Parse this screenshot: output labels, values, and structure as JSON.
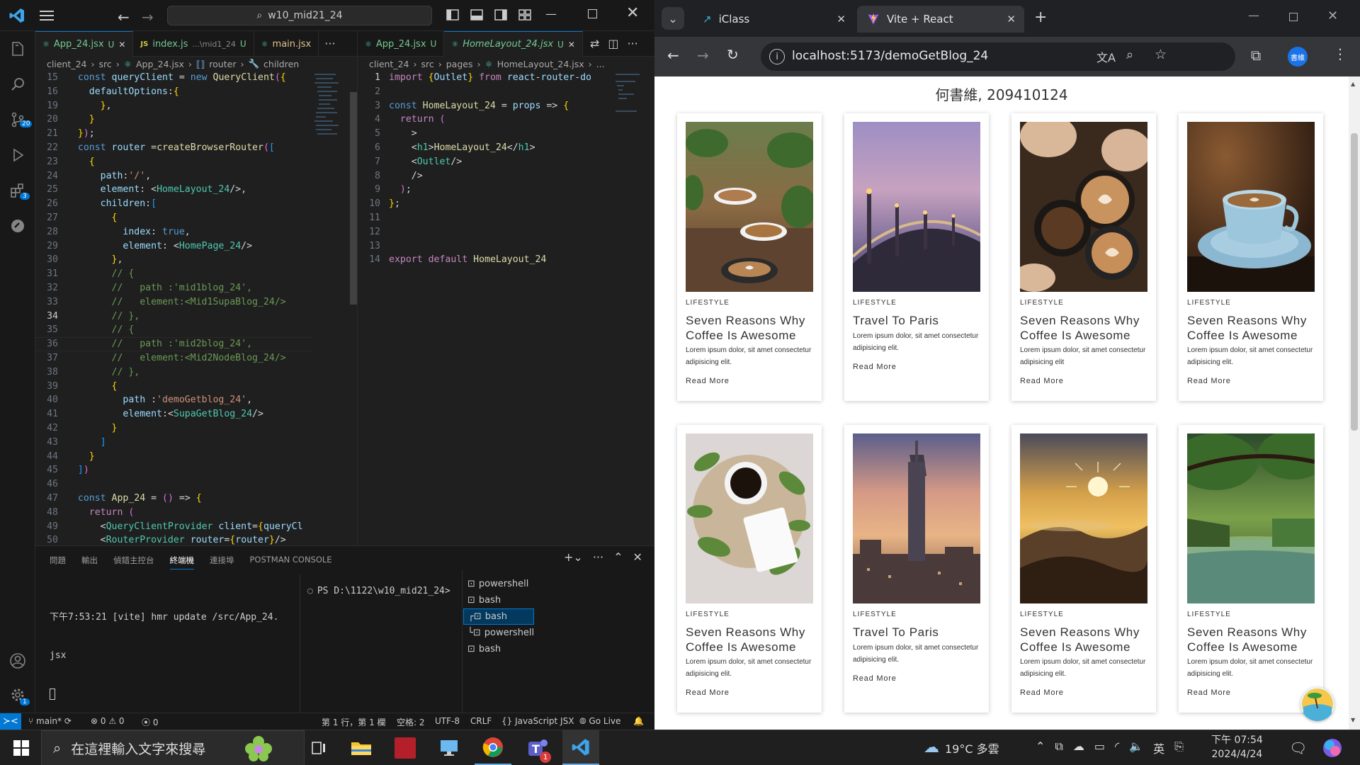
{
  "vscode": {
    "search_text": "w10_mid21_24",
    "activity_badges": {
      "source_control": "20",
      "extensions": "3",
      "manage": "1"
    },
    "left_tabs": [
      {
        "label": "App_24.jsx",
        "suffix": "U",
        "italic": false
      },
      {
        "label": "index.js",
        "detail": "...\\mid1_24",
        "suffix": "U"
      },
      {
        "label": "main.jsx",
        "suffix": ""
      }
    ],
    "right_tabs": [
      {
        "label": "App_24.jsx",
        "suffix": "U"
      },
      {
        "label": "HomeLayout_24.jsx",
        "suffix": "U"
      }
    ],
    "left_breadcrumb": [
      "client_24",
      "src",
      "App_24.jsx",
      "router",
      "children"
    ],
    "right_breadcrumb": [
      "client_24",
      "src",
      "pages",
      "HomeLayout_24.jsx",
      "..."
    ],
    "left_line_numbers": [
      "15",
      "16",
      "19",
      "20",
      "21",
      "22",
      "23",
      "24",
      "25",
      "26",
      "27",
      "28",
      "29",
      "30",
      "31",
      "32",
      "33",
      "34",
      "35",
      "36",
      "37",
      "38",
      "39",
      "40",
      "41",
      "42",
      "43",
      "44",
      "45",
      "46",
      "47",
      "48",
      "49",
      "50"
    ],
    "left_code": [
      "  const queryClient = new QueryClient({",
      "    defaultOptions:{",
      "      },",
      "    }",
      "  });",
      "  const router =createBrowserRouter([",
      "    {",
      "      path:'/',",
      "      element: <HomeLayout_24/>,",
      "      children:[",
      "        {",
      "          index: true,",
      "          element: <HomePage_24/>",
      "        },",
      "        // {",
      "        //   path :'mid1blog_24',",
      "        //   element:<Mid1SupaBlog_24/>",
      "        // },",
      "        // {",
      "        //   path :'mid2blog_24',",
      "        //   element:<Mid2NodeBlog_24/>",
      "        // },",
      "        {",
      "          path :'demoGetblog_24',",
      "          element:<SupaGetBlog_24/>",
      "        }",
      "      ]",
      "    }",
      "  ])",
      "",
      "  const App_24 = () => {",
      "    return (",
      "      <QueryClientProvider client={queryCl",
      "      <RouterProvider router={router}/>"
    ],
    "right_line_numbers": [
      "1",
      "2",
      "3",
      "4",
      "5",
      "6",
      "7",
      "8",
      "9",
      "10",
      "11",
      "12",
      "13",
      "14"
    ],
    "right_code": [
      "import {Outlet} from 'react-router-do",
      "",
      "const HomeLayout_24 = props => {",
      "  return (",
      "    <>",
      "    <h1>HomeLayout_24</h1>",
      "    <Outlet/>",
      "    </>",
      "  );",
      "};",
      "",
      "",
      "",
      "export default HomeLayout_24"
    ],
    "panel_tabs": [
      "問題",
      "輸出",
      "偵錯主控台",
      "終端機",
      "連接埠",
      "POSTMAN CONSOLE"
    ],
    "terminal_left": [
      "下午7:53:21 [vite] hmr update /src/App_24.",
      "jsx"
    ],
    "terminal_right": "PS D:\\1122\\w10_mid21_24>",
    "terminal_list": [
      "powershell",
      "bash",
      "bash",
      "powershell",
      "bash"
    ],
    "status": {
      "branch": "main*",
      "problems": "0",
      "warnings": "0",
      "ports": "0",
      "position": "第 1 行，第 1 欄",
      "spaces": "空格: 2",
      "encoding": "UTF-8",
      "eol": "CRLF",
      "language": "JavaScript JSX",
      "golive": "Go Live"
    }
  },
  "chrome": {
    "tabs": [
      {
        "label": "iClass"
      },
      {
        "label": "Vite + React"
      }
    ],
    "url": "localhost:5173/demoGetBlog_24",
    "profile": "書維",
    "page_heading": "何書維, 209410124",
    "cards": [
      {
        "category": "LIFESTYLE",
        "title": "Seven Reasons Why Coffee Is Awesome",
        "desc": "Lorem ipsum dolor, sit amet consectetur adipisicing elit.",
        "read": "Read More",
        "image": "coffee-cups-plants"
      },
      {
        "category": "LIFESTYLE",
        "title": "Travel To Paris",
        "desc": "Lorem ipsum dolor, sit amet consectetur adipisicing elit.",
        "read": "Read More",
        "image": "paris-bridge"
      },
      {
        "category": "LIFESTYLE",
        "title": "Seven Reasons Why Coffee Is Awesome",
        "desc": "Lorem ipsum dolor, sit amet consectetur adipisicing elit",
        "read": "Read More",
        "image": "latte-toast"
      },
      {
        "category": "LIFESTYLE",
        "title": "Seven Reasons Why Coffee Is Awesome",
        "desc": "Lorem ipsum dolor, sit amet consectetur adipisicing elit.",
        "read": "Read More",
        "image": "espresso-cup"
      },
      {
        "category": "LIFESTYLE",
        "title": "Seven Reasons Why Coffee Is Awesome",
        "desc": "Lorem ipsum dolor, sit amet consectetur adipisicing elit.",
        "read": "Read More",
        "image": "coffee-leaves-flatlay"
      },
      {
        "category": "LIFESTYLE",
        "title": "Travel To Paris",
        "desc": "Lorem ipsum dolor, sit amet consectetur adipisicing elit.",
        "read": "Read More",
        "image": "taipei-101"
      },
      {
        "category": "LIFESTYLE",
        "title": "Seven Reasons Why Coffee Is Awesome",
        "desc": "Lorem ipsum dolor, sit amet consectetur adipisicing elit.",
        "read": "Read More",
        "image": "sunrise-mountains"
      },
      {
        "category": "LIFESTYLE",
        "title": "Seven Reasons Why Coffee Is Awesome",
        "desc": "Lorem ipsum dolor, sit amet consectetur adipisicing elit.",
        "read": "Read More",
        "image": "forest-river"
      }
    ]
  },
  "taskbar": {
    "search_placeholder": "在這裡輸入文字來搜尋",
    "weather": "19°C 多雲",
    "ime": "英",
    "time": "下午 07:54",
    "date": "2024/4/24",
    "teams_badge": "1"
  }
}
